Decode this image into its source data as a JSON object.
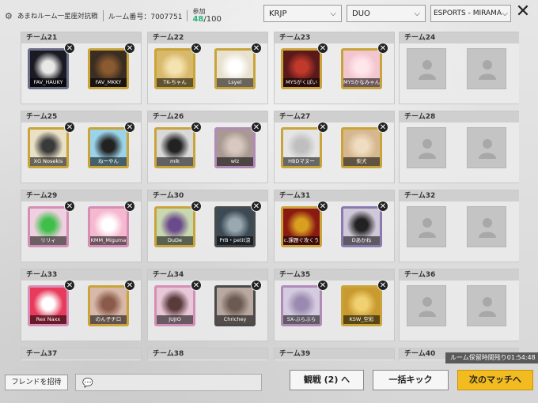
{
  "header": {
    "room_name": "あまねルーム一星座対抗戦",
    "room_number_label": "ルーム番号：",
    "room_number": "7007751",
    "participants_label": "参加",
    "participants_current": "48",
    "participants_max": "/100",
    "dropdowns": [
      {
        "name": "server",
        "value": "KRJP"
      },
      {
        "name": "mode",
        "value": "DUO"
      },
      {
        "name": "map",
        "value": "ESPORTS - MIRAMA"
      }
    ]
  },
  "teams": [
    {
      "label": "チーム21",
      "members": [
        {
          "name": "FAV_HAUKY",
          "bg": "#1a1a22",
          "accent": "#e8e8e8",
          "frame": "#6b6f8a"
        },
        {
          "name": "FAV_MKKY",
          "bg": "#3a2d22",
          "accent": "#8a5a30",
          "frame": "#c9a43a"
        }
      ]
    },
    {
      "label": "チーム22",
      "members": [
        {
          "name": "TK-ちゃん",
          "bg": "#d8b86a",
          "accent": "#f4e3b0",
          "frame": "#c9a43a"
        },
        {
          "name": "Lsyel",
          "bg": "#e9e1cf",
          "accent": "#ffffff",
          "frame": "#c9a43a"
        }
      ]
    },
    {
      "label": "チーム23",
      "members": [
        {
          "name": "MYSがくぽい",
          "bg": "#5a1a1a",
          "accent": "#c0392b",
          "frame": "#c9a43a"
        },
        {
          "name": "MYSかなみゃん",
          "bg": "#f2c6cf",
          "accent": "#ffe6ea",
          "frame": "#c9a43a"
        }
      ]
    },
    {
      "label": "チーム24",
      "members": []
    },
    {
      "label": "チーム25",
      "members": [
        {
          "name": "XG Nosekis",
          "bg": "#e9e0c5",
          "accent": "#3a3a3a",
          "frame": "#c9a43a"
        },
        {
          "name": "ねーやん",
          "bg": "#9bd3e8",
          "accent": "#222222",
          "frame": "#c9a43a"
        }
      ]
    },
    {
      "label": "チーム26",
      "members": [
        {
          "name": "mlk",
          "bg": "#d9d9d9",
          "accent": "#222222",
          "frame": "#c9a43a"
        },
        {
          "name": "wlz",
          "bg": "#a89a92",
          "accent": "#d8c8c0",
          "frame": "#b28ab8"
        }
      ]
    },
    {
      "label": "チーム27",
      "members": [
        {
          "name": "HBDマヌー",
          "bg": "#e5e5e5",
          "accent": "#bfbfbf",
          "frame": "#c9a43a"
        },
        {
          "name": "梨犬",
          "bg": "#d6b890",
          "accent": "#f0dcc0",
          "frame": "#c9a43a"
        }
      ]
    },
    {
      "label": "チーム28",
      "members": []
    },
    {
      "label": "チーム29",
      "members": [
        {
          "name": "リリィ",
          "bg": "#efd0e0",
          "accent": "#3fbf4a",
          "frame": "#d48fb6"
        },
        {
          "name": "KMM_Miguma",
          "bg": "#f5b8cf",
          "accent": "#ffffff",
          "frame": "#d48fb6"
        }
      ]
    },
    {
      "label": "チーム30",
      "members": [
        {
          "name": "DuDe",
          "bg": "#c8d8b0",
          "accent": "#6a4a8a",
          "frame": "#c9a43a"
        },
        {
          "name": "PrB・petit涼",
          "bg": "#3b4a55",
          "accent": "#9aa8b0",
          "frame": "#4a4a4a"
        }
      ]
    },
    {
      "label": "チーム31",
      "members": [
        {
          "name": "c.課題ぐ攻くう",
          "bg": "#8a1a12",
          "accent": "#d9a020",
          "frame": "#c9a43a"
        },
        {
          "name": "Dあかね",
          "bg": "#cfc8d8",
          "accent": "#222222",
          "frame": "#8a7ab0"
        }
      ]
    },
    {
      "label": "チーム32",
      "members": []
    },
    {
      "label": "チーム33",
      "members": [
        {
          "name": "Rex Naxx",
          "bg": "#e83a5a",
          "accent": "#ffffff",
          "frame": "#d48fb6"
        },
        {
          "name": "のん子チロ",
          "bg": "#d8b8a8",
          "accent": "#8a5a4a",
          "frame": "#c9a43a"
        }
      ]
    },
    {
      "label": "チーム34",
      "members": [
        {
          "name": "JUJIO",
          "bg": "#e8c8d8",
          "accent": "#5a3a3a",
          "frame": "#d48fb6"
        },
        {
          "name": "Chrichey",
          "bg": "#b8a8a0",
          "accent": "#6a5a52",
          "frame": "#4a4a4a"
        }
      ]
    },
    {
      "label": "チーム35",
      "members": [
        {
          "name": "SX-ぶらぶら",
          "bg": "#d4cbe0",
          "accent": "#9a8ab0",
          "frame": "#b28ab8"
        },
        {
          "name": "KSW_空彩",
          "bg": "#c89a30",
          "accent": "#f0d070",
          "frame": "#c9a43a"
        }
      ]
    },
    {
      "label": "チーム36",
      "members": []
    },
    {
      "label": "チーム37",
      "members": []
    },
    {
      "label": "チーム38",
      "members": []
    },
    {
      "label": "チーム39",
      "members": []
    },
    {
      "label": "チーム40",
      "members": []
    }
  ],
  "footer": {
    "invite_label": "フレンドを招待",
    "chat_icon": "chat-bubble-icon",
    "spectate_label": "観戦 (2) へ",
    "kick_all_label": "一括キック",
    "next_match_label": "次のマッチへ",
    "hold_time_label": "ルーム保留時間残り",
    "hold_time_value": "01:54:48"
  }
}
